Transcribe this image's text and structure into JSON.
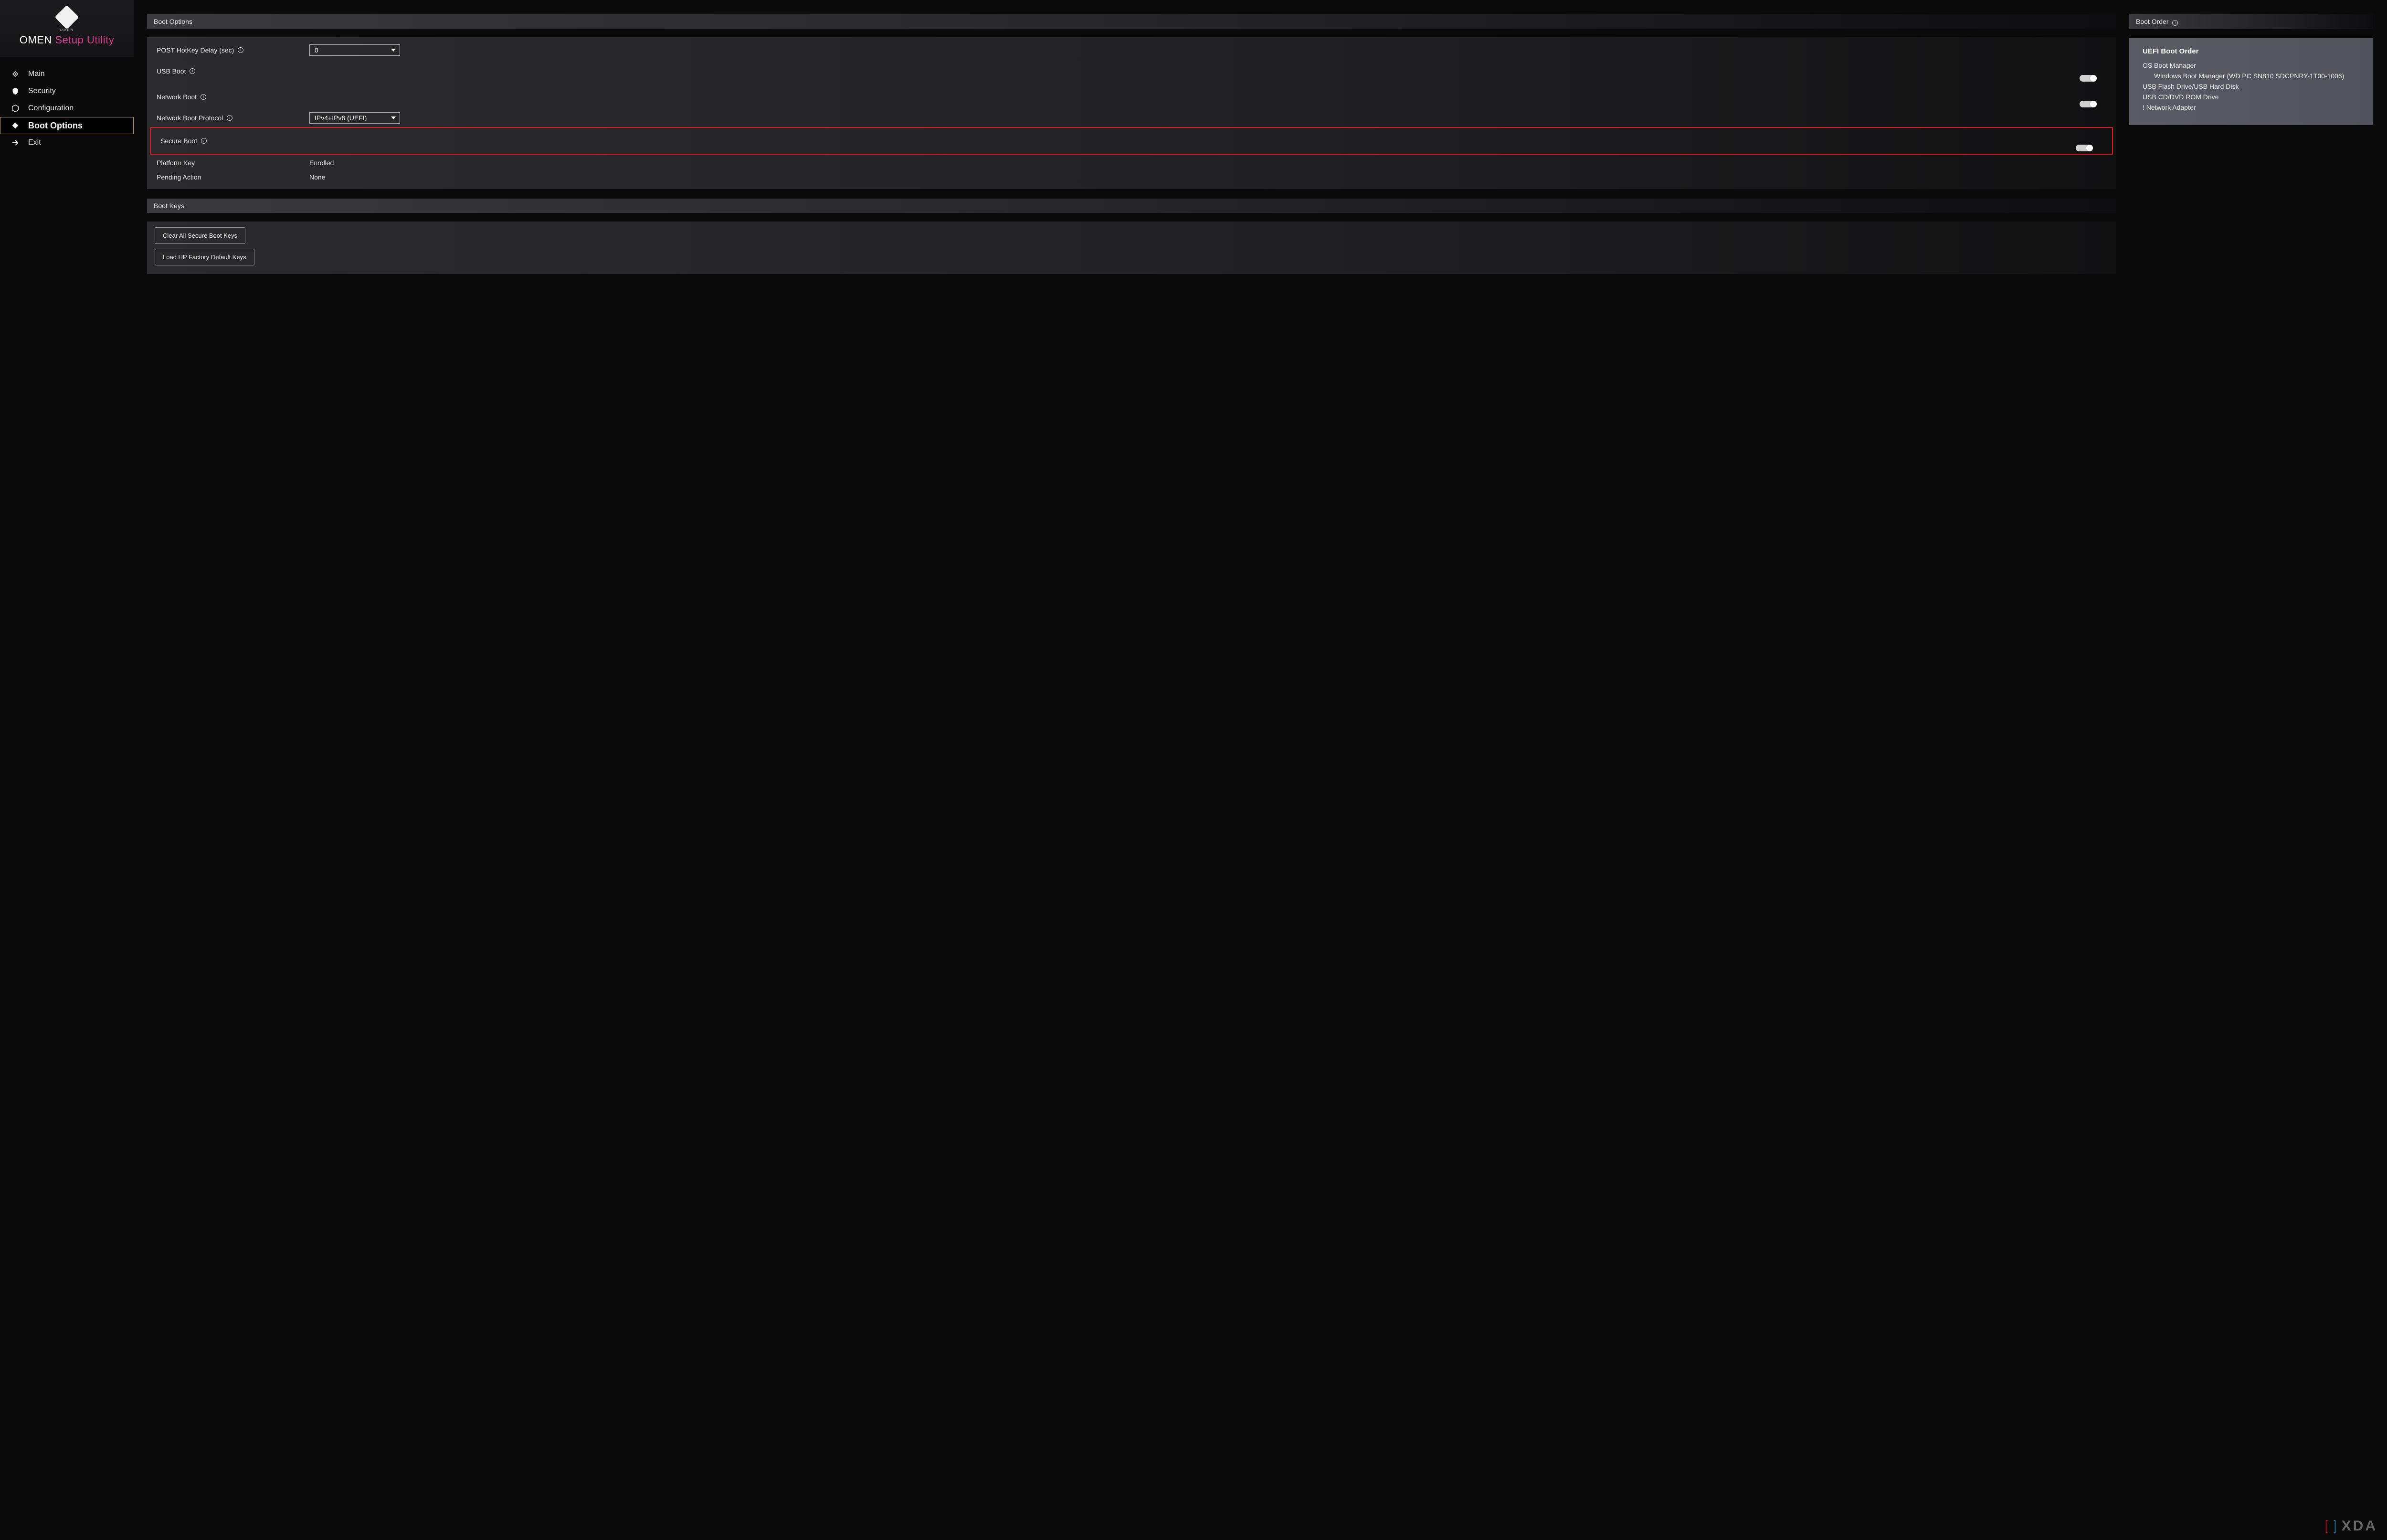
{
  "branding": {
    "logo_sub": "OMEN",
    "title_part1": "OMEN ",
    "title_part2": "Setup ",
    "title_part3": "Utility"
  },
  "nav": {
    "items": [
      {
        "label": "Main",
        "icon": "diamond-icon"
      },
      {
        "label": "Security",
        "icon": "shield-icon"
      },
      {
        "label": "Configuration",
        "icon": "hex-icon"
      },
      {
        "label": "Boot Options",
        "icon": "diamond-filled-icon",
        "selected": true
      },
      {
        "label": "Exit",
        "icon": "arrow-right-icon"
      }
    ]
  },
  "boot_options": {
    "panel_title": "Boot Options",
    "rows": {
      "post_hotkey_label": "POST HotKey Delay (sec)",
      "post_hotkey_value": "0",
      "usb_boot_label": "USB Boot",
      "usb_boot_on": true,
      "network_boot_label": "Network Boot",
      "network_boot_on": true,
      "network_proto_label": "Network Boot Protocol",
      "network_proto_value": "IPv4+IPv6 (UEFI)",
      "secure_boot_label": "Secure Boot",
      "secure_boot_on": true,
      "platform_key_label": "Platform Key",
      "platform_key_value": "Enrolled",
      "pending_action_label": "Pending Action",
      "pending_action_value": "None"
    }
  },
  "boot_keys": {
    "panel_title": "Boot Keys",
    "clear_label": "Clear All Secure Boot Keys",
    "load_label": "Load HP Factory Default Keys"
  },
  "boot_order": {
    "panel_title": "Boot Order",
    "heading": "UEFI Boot Order",
    "items": [
      {
        "label": "OS Boot Manager"
      },
      {
        "label": "Windows Boot Manager (WD PC SN810 SDCPNRY-1T00-1006)",
        "indent": true
      },
      {
        "label": "USB Flash Drive/USB Hard Disk"
      },
      {
        "label": "USB CD/DVD ROM Drive"
      },
      {
        "label": "! Network Adapter"
      }
    ]
  },
  "watermark": {
    "text": "XDA"
  }
}
